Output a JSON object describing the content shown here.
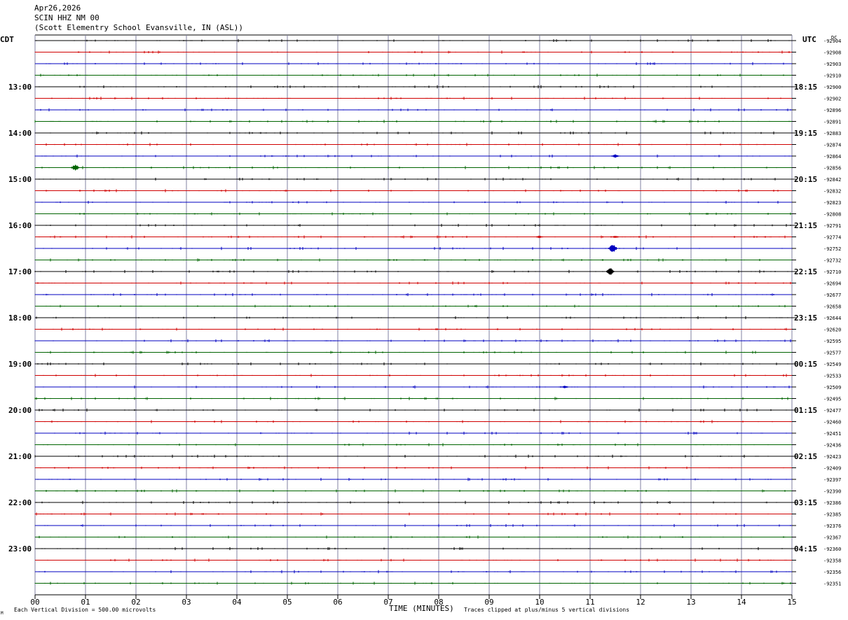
{
  "header": {
    "date": "Apr26,2026",
    "station": "SCIN HHZ NM 00",
    "location": "(Scott Elementry School Evansville, IN (ASL))"
  },
  "footer": {
    "scale_note": "Each Vertical Division =  500.00 microvolts",
    "clip_note": "Traces clipped at plus/minus 5 vertical divisions",
    "corner_mark": "M"
  },
  "chart_data": {
    "type": "line",
    "subtype": "helicorder",
    "xlabel": "TIME (MINUTES)",
    "x_ticks": [
      "00",
      "01",
      "02",
      "03",
      "04",
      "05",
      "06",
      "07",
      "08",
      "09",
      "10",
      "11",
      "12",
      "13",
      "14",
      "15"
    ],
    "xlim": [
      0,
      15
    ],
    "left_axis_label": "CDT",
    "right_axis_label": "UTC",
    "dc_label": "DC",
    "left_hour_labels": [
      "13:00",
      "14:00",
      "15:00",
      "16:00",
      "17:00",
      "18:00",
      "19:00",
      "20:00",
      "21:00",
      "22:00",
      "23:00"
    ],
    "right_hour_labels": [
      "18:15",
      "19:15",
      "20:15",
      "21:15",
      "22:15",
      "23:15",
      "00:15",
      "01:15",
      "02:15",
      "03:15",
      "04:15"
    ],
    "dc_offsets": [
      "-92904",
      "-92908",
      "-92903",
      "-92910",
      "-92900",
      "-92902",
      "-92896",
      "-92891",
      "-92883",
      "-92874",
      "-92864",
      "-92856",
      "-92842",
      "-92832",
      "-92823",
      "-92808",
      "-92791",
      "-92774",
      "-92752",
      "-92732",
      "-92710",
      "-92694",
      "-92677",
      "-92658",
      "-92644",
      "-92620",
      "-92595",
      "-92577",
      "-92549",
      "-92533",
      "-92509",
      "-92495",
      "-92477",
      "-92460",
      "-92451",
      "-92436",
      "-92423",
      "-92409",
      "-92397",
      "-92390",
      "-92386",
      "-92385",
      "-92376",
      "-92367",
      "-92360",
      "-92358",
      "-92356",
      "-92351"
    ],
    "trace_colors": [
      "#000000",
      "#d00000",
      "#0000c0",
      "#006400"
    ],
    "grid_color": "#8080a0",
    "grid": true,
    "events": [
      {
        "trace": 11,
        "minute": 0.8,
        "amplitude": 5
      },
      {
        "trace": 10,
        "minute": 11.5,
        "amplitude": 3
      },
      {
        "trace": 17,
        "minute": 10.0,
        "amplitude": 2
      },
      {
        "trace": 17,
        "minute": 11.5,
        "amplitude": 2
      },
      {
        "trace": 18,
        "minute": 11.45,
        "amplitude": 7
      },
      {
        "trace": 20,
        "minute": 11.4,
        "amplitude": 6
      },
      {
        "trace": 30,
        "minute": 10.5,
        "amplitude": 2
      }
    ]
  }
}
